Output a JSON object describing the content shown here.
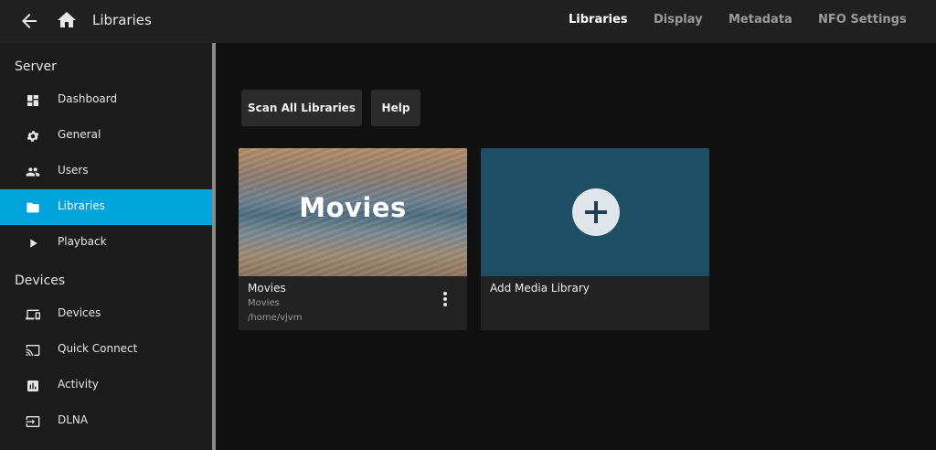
{
  "header": {
    "title": "Libraries",
    "tabs": [
      {
        "label": "Libraries",
        "active": true
      },
      {
        "label": "Display",
        "active": false
      },
      {
        "label": "Metadata",
        "active": false
      },
      {
        "label": "NFO Settings",
        "active": false
      }
    ],
    "icons": [
      "back-arrow-icon",
      "home-icon"
    ]
  },
  "sidebar": {
    "server_title": "Server",
    "server_items": [
      {
        "label": "Dashboard",
        "icon": "dashboard-icon"
      },
      {
        "label": "General",
        "icon": "gear-icon"
      },
      {
        "label": "Users",
        "icon": "users-icon"
      },
      {
        "label": "Libraries",
        "icon": "folder-icon",
        "active": true
      },
      {
        "label": "Playback",
        "icon": "play-icon"
      }
    ],
    "devices_title": "Devices",
    "device_items": [
      {
        "label": "Devices",
        "icon": "devices-icon"
      },
      {
        "label": "Quick Connect",
        "icon": "cast-icon"
      },
      {
        "label": "Activity",
        "icon": "activity-icon"
      },
      {
        "label": "DLNA",
        "icon": "input-icon"
      }
    ]
  },
  "toolbar": {
    "scan_label": "Scan All Libraries",
    "help_label": "Help"
  },
  "libraries": [
    {
      "banner": "Movies",
      "name": "Movies",
      "type": "Movies",
      "path": "/home/vjvm"
    }
  ],
  "add_card": {
    "label": "Add Media Library",
    "icon": "plus-icon"
  },
  "colors": {
    "accent": "#00a4dc",
    "topbar": "#202020",
    "background": "#101010",
    "add_card_bg": "#1d4e63"
  }
}
